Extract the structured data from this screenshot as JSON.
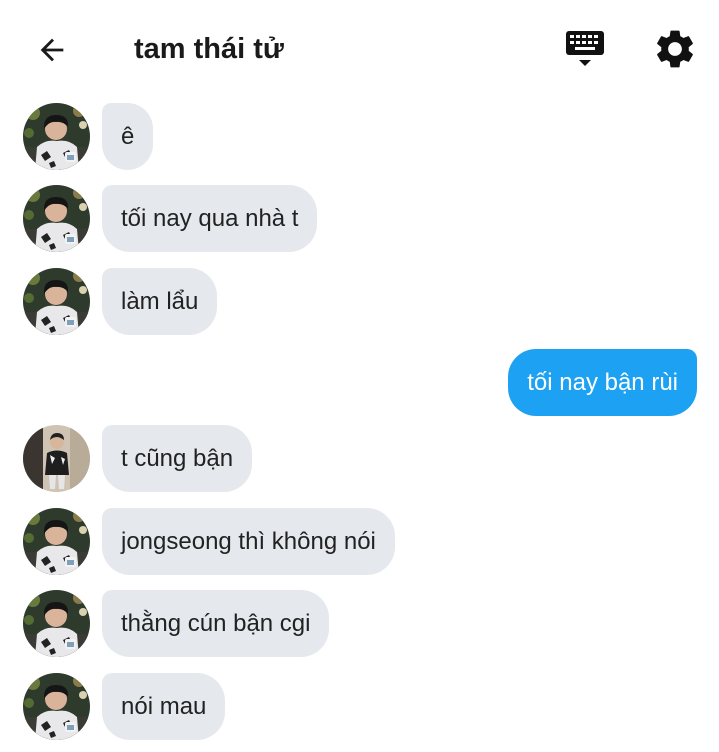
{
  "header": {
    "title": "tam thái tử",
    "icons": {
      "back": "arrow-left-icon",
      "keyboard": "keyboard-icon",
      "settings": "gear-icon"
    }
  },
  "messages": [
    {
      "text": "ê",
      "direction": "incoming",
      "avatar": "avatar-a"
    },
    {
      "text": "tối nay qua nhà t",
      "direction": "incoming",
      "avatar": "avatar-a"
    },
    {
      "text": "làm lẩu",
      "direction": "incoming",
      "avatar": "avatar-a"
    },
    {
      "text": "tối nay bận rùi",
      "direction": "outgoing"
    },
    {
      "text": "t cũng bận",
      "direction": "incoming",
      "avatar": "avatar-b"
    },
    {
      "text": "jongseong thì không nói",
      "direction": "incoming",
      "avatar": "avatar-a"
    },
    {
      "text": "thằng cún bận cgi",
      "direction": "incoming",
      "avatar": "avatar-a"
    },
    {
      "text": "nói mau",
      "direction": "incoming",
      "avatar": "avatar-a"
    }
  ],
  "colors": {
    "incoming_bubble": "#e5e9ed",
    "outgoing_bubble": "#1da1f2"
  }
}
